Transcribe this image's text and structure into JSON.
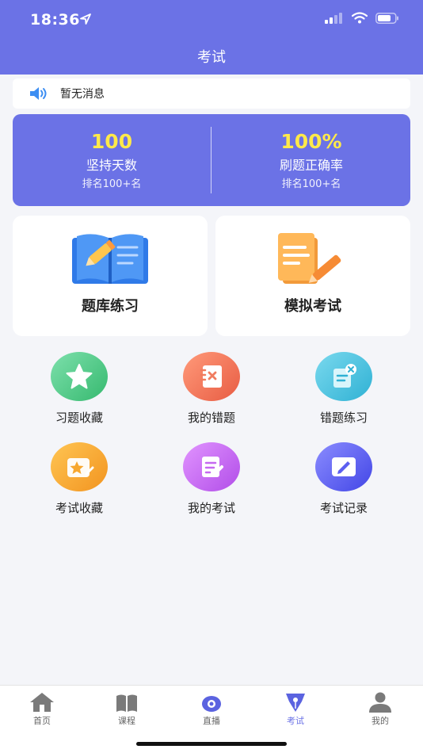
{
  "status": {
    "time": "18:36"
  },
  "header": {
    "title": "考试"
  },
  "notice": {
    "text": "暂无消息"
  },
  "stats": {
    "left": {
      "value": "100",
      "label": "坚持天数",
      "rank": "排名100+名"
    },
    "right": {
      "value": "100%",
      "label": "刷题正确率",
      "rank": "排名100+名"
    }
  },
  "cards": [
    {
      "label": "题库练习"
    },
    {
      "label": "模拟考试"
    }
  ],
  "grid": [
    {
      "label": "习题收藏",
      "color": "#4fd08a"
    },
    {
      "label": "我的错题",
      "color": "#f2775a"
    },
    {
      "label": "错题练习",
      "color": "#43c0de"
    },
    {
      "label": "考试收藏",
      "color": "#f7a72f"
    },
    {
      "label": "我的考试",
      "color": "#c569f0"
    },
    {
      "label": "考试记录",
      "color": "#5c5ff0"
    }
  ],
  "tabs": [
    {
      "label": "首页"
    },
    {
      "label": "课程"
    },
    {
      "label": "直播"
    },
    {
      "label": "考试"
    },
    {
      "label": "我的"
    }
  ],
  "colors": {
    "primary": "#6b72e6",
    "highlight": "#ffe94a"
  }
}
